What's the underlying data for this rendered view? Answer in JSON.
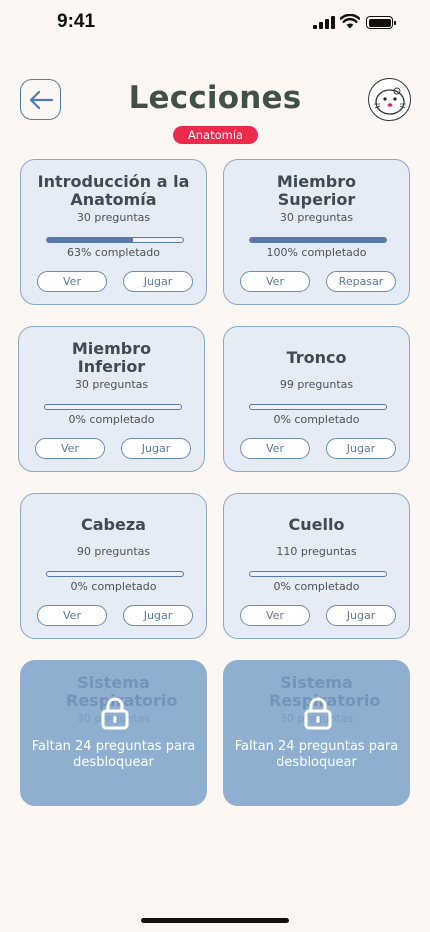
{
  "status_bar": {
    "time": "9:41"
  },
  "header": {
    "title": "Lecciones",
    "category": "Anatomía",
    "back_icon": "arrow-left-icon",
    "avatar_icon": "seal-avatar"
  },
  "colors": {
    "background": "#fcf7f3",
    "card_bg": "#e5ecf5",
    "card_border": "#8aa8c8",
    "progress": "#5777a8",
    "badge": "#ee2a4c",
    "locked_bg": "#8fafd1",
    "title": "#3f5149"
  },
  "lessons": [
    {
      "title": "Introducción a la Anatomía",
      "count": "30 preguntas",
      "progress": 0.63,
      "progress_label": "63% completado",
      "view_label": "Ver",
      "action_label": "Jugar"
    },
    {
      "title": "Miembro Superior",
      "count": "30 preguntas",
      "progress": 1.0,
      "progress_label": "100% completado",
      "view_label": "Ver",
      "action_label": "Repasar"
    },
    {
      "title": "Miembro Inferior",
      "count": "30 preguntas",
      "progress": 0,
      "progress_label": "0% completado",
      "view_label": "Ver",
      "action_label": "Jugar"
    },
    {
      "title": "Tronco",
      "count": "99 preguntas",
      "progress": 0,
      "progress_label": "0% completado",
      "view_label": "Ver",
      "action_label": "Jugar"
    },
    {
      "title": "Cabeza",
      "count": "90 preguntas",
      "progress": 0,
      "progress_label": "0% completado",
      "view_label": "Ver",
      "action_label": "Jugar"
    },
    {
      "title": "Cuello",
      "count": "110 preguntas",
      "progress": 0,
      "progress_label": "0% completado",
      "view_label": "Ver",
      "action_label": "Jugar"
    }
  ],
  "locked_lessons": [
    {
      "title": "Sistema Respiratorio",
      "count": "30 preguntas",
      "message": "Faltan 24 preguntas para desbloquear",
      "icon": "lock-icon"
    },
    {
      "title": "Sistema Respiratorio",
      "count": "30 preguntas",
      "message": "Faltan 24 preguntas para desbloquear",
      "icon": "lock-icon"
    }
  ]
}
